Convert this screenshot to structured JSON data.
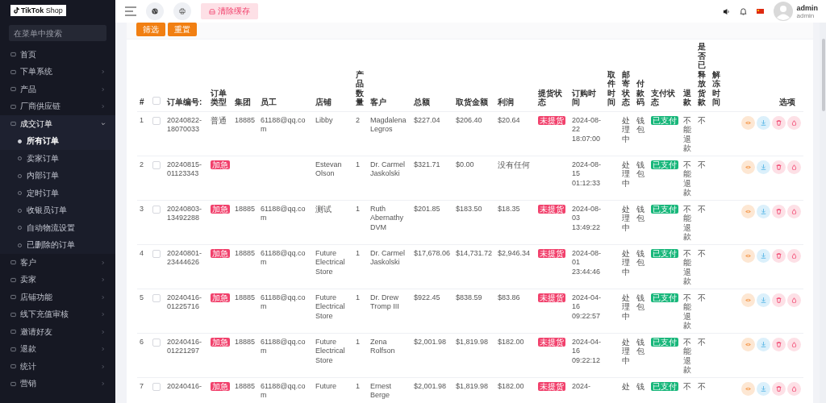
{
  "sidebar": {
    "logo": "**TikTok** Shop",
    "search": {
      "placeholder": "在菜单中搜索"
    },
    "items": [
      {
        "label": "首页"
      },
      {
        "label": "下单系统",
        "expanded": false
      },
      {
        "label": "产品",
        "expanded": false
      },
      {
        "label": "厂商供应链",
        "expanded": false
      },
      {
        "label": "成交订单",
        "expanded": true,
        "children": [
          {
            "label": "所有订单",
            "selected": true
          },
          {
            "label": "卖家订单",
            "selected": false
          },
          {
            "label": "内部订单",
            "selected": false
          },
          {
            "label": "定时订单",
            "selected": false
          },
          {
            "label": "收银员订单",
            "selected": false
          },
          {
            "label": "自动物流设置",
            "selected": false
          },
          {
            "label": "已删除的订单",
            "selected": false
          }
        ]
      },
      {
        "label": "客户",
        "expanded": false
      },
      {
        "label": "卖家",
        "expanded": false
      },
      {
        "label": "店铺功能",
        "expanded": false
      },
      {
        "label": "线下充值审核",
        "expanded": false
      },
      {
        "label": "邀请好友",
        "expanded": false
      },
      {
        "label": "退款",
        "expanded": false
      },
      {
        "label": "统计",
        "expanded": false
      },
      {
        "label": "营销",
        "expanded": false
      }
    ]
  },
  "header": {
    "clear_cache": "清除缓存",
    "user": {
      "name": "admin",
      "role": "admin"
    }
  },
  "filters": {
    "buttons": [
      "筛选",
      "重置"
    ]
  },
  "table": {
    "columns": [
      "#",
      "订单编号:",
      "订单类型",
      "集团",
      "员工",
      "店铺",
      "产品数量",
      "客户",
      "总额",
      "取货金额",
      "利润",
      "提货状态",
      "订购时间",
      "取件时间",
      "邮寄状态",
      "付款码",
      "支付状态",
      "退款",
      "是否已释放货款",
      "解冻时间",
      "选项"
    ],
    "header_checked": false,
    "row_actions": [
      {
        "kind": "eye"
      },
      {
        "kind": "download"
      },
      {
        "kind": "trash"
      },
      {
        "kind": "drop"
      }
    ],
    "rows": [
      {
        "index": "1",
        "checked": false,
        "order_no": "20240822-18070033",
        "order_type": "普通",
        "urgent": false,
        "group": "18885",
        "employee": "61188@qq.com",
        "store": "Libby",
        "quantity": "2",
        "customer": "Magdalena Legros",
        "total": "$227.04",
        "pickup_amount": "$206.40",
        "profit": "$20.64",
        "pickup_status": "未提货",
        "order_time": "2024-08-22 18:07:00",
        "ship_status": "处理中",
        "payment_code": "钱包",
        "payment_status": "已支付",
        "refund": "不能退款",
        "released": "不"
      },
      {
        "index": "2",
        "checked": false,
        "order_no": "20240815-01123343",
        "order_type": "加急",
        "urgent": true,
        "store": "Estevan Olson",
        "quantity": "1",
        "customer": "Dr. Carmel Jaskolski",
        "total": "$321.71",
        "pickup_amount": "$0.00",
        "profit": "没有任何",
        "order_time": "2024-08-15 01:12:33",
        "ship_status": "处理中",
        "payment_code": "钱包",
        "payment_status": "已支付",
        "refund": "不能退款",
        "released": "不"
      },
      {
        "index": "3",
        "checked": false,
        "order_no": "20240803-13492288",
        "order_type": "加急",
        "urgent": true,
        "group": "18885",
        "employee": "61188@qq.com",
        "store": "测试",
        "quantity": "1",
        "customer": "Ruth Abernathy DVM",
        "total": "$201.85",
        "pickup_amount": "$183.50",
        "profit": "$18.35",
        "pickup_status": "未提货",
        "order_time": "2024-08-03 13:49:22",
        "ship_status": "处理中",
        "payment_code": "钱包",
        "payment_status": "已支付",
        "refund": "不能退款",
        "released": "不"
      },
      {
        "index": "4",
        "checked": false,
        "order_no": "20240801-23444626",
        "order_type": "加急",
        "urgent": true,
        "group": "18885",
        "employee": "61188@qq.com",
        "store": "Future Electrical Store",
        "quantity": "1",
        "customer": "Dr. Carmel Jaskolski",
        "total": "$17,678.06",
        "pickup_amount": "$14,731.72",
        "profit": "$2,946.34",
        "pickup_status": "未提货",
        "order_time": "2024-08-01 23:44:46",
        "ship_status": "处理中",
        "payment_code": "钱包",
        "payment_status": "已支付",
        "refund": "不能退款",
        "released": "不"
      },
      {
        "index": "5",
        "checked": false,
        "order_no": "20240416-01225716",
        "order_type": "加急",
        "urgent": true,
        "group": "18885",
        "employee": "61188@qq.com",
        "store": "Future Electrical Store",
        "quantity": "1",
        "customer": "Dr. Drew Tromp III",
        "total": "$922.45",
        "pickup_amount": "$838.59",
        "profit": "$83.86",
        "pickup_status": "未提货",
        "order_time": "2024-04-16 09:22:57",
        "ship_status": "处理中",
        "payment_code": "钱包",
        "payment_status": "已支付",
        "refund": "不能退款",
        "released": "不"
      },
      {
        "index": "6",
        "checked": false,
        "order_no": "20240416-01221297",
        "order_type": "加急",
        "urgent": true,
        "group": "18885",
        "employee": "61188@qq.com",
        "store": "Future Electrical Store",
        "quantity": "1",
        "customer": "Zena Rolfson",
        "total": "$2,001.98",
        "pickup_amount": "$1,819.98",
        "profit": "$182.00",
        "pickup_status": "未提货",
        "order_time": "2024-04-16 09:22:12",
        "ship_status": "处理中",
        "payment_code": "钱包",
        "payment_status": "已支付",
        "refund": "不能退款",
        "released": "不"
      },
      {
        "index": "7",
        "checked": false,
        "order_no": "20240416-",
        "order_type": "加急",
        "urgent": true,
        "group": "18885",
        "employee": "61188@qq.com",
        "store": "Future",
        "quantity": "1",
        "customer": "Ernest Berge",
        "total": "$2,001.98",
        "pickup_amount": "$1,819.98",
        "profit": "$182.00",
        "pickup_status": "未提货",
        "order_time": "2024-",
        "ship_status": "处",
        "payment_code": "钱",
        "payment_status": "已支付",
        "refund": "不",
        "released": "不"
      }
    ]
  }
}
